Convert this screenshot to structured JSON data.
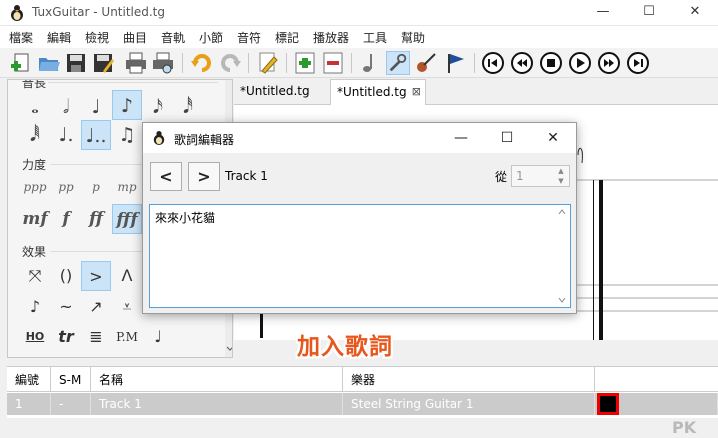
{
  "window": {
    "title": "TuxGuitar - Untitled.tg",
    "minimize": "—",
    "maximize": "☐",
    "close": "✕"
  },
  "menu": [
    "檔案",
    "編輯",
    "檢視",
    "曲目",
    "音軌",
    "小節",
    "音符",
    "標記",
    "播放器",
    "工具",
    "幫助"
  ],
  "palette": {
    "duration_header": "音長",
    "dynamics_header": "力度",
    "dynamics_row1": [
      "ppp",
      "pp",
      "p",
      "mp"
    ],
    "dynamics_row2": [
      "mf",
      "f",
      "ff",
      "fff"
    ],
    "effects_header": "效果",
    "effects_row1": [
      "⤧",
      "()",
      ">",
      "Λ"
    ],
    "effects_row2": [
      "♪",
      "~",
      "↗",
      "⩡"
    ],
    "effects_row3": [
      "HO",
      "tr",
      "≣",
      "P.M",
      "♩"
    ]
  },
  "tabs": {
    "tab1": "*Untitled.tg",
    "tab2": "*Untitled.tg",
    "tab2_close": "⊠"
  },
  "table": {
    "headers": [
      "編號",
      "S-M",
      "名稱",
      "樂器"
    ],
    "row": [
      "1",
      "-",
      "Track 1",
      "Steel String Guitar 1"
    ],
    "color_hex": "#000000"
  },
  "dialog": {
    "title": "歌詞編輯器",
    "prev": "<",
    "next": ">",
    "track": "Track 1",
    "from_label": "從",
    "from_value": "1",
    "lyrics": "來來小花貓"
  },
  "annotation": "加入歌詞",
  "watermark": "PK",
  "colors": {
    "accent": "#e8561c",
    "selection": "#cce4f7",
    "table_row": "#cbcbcb"
  }
}
